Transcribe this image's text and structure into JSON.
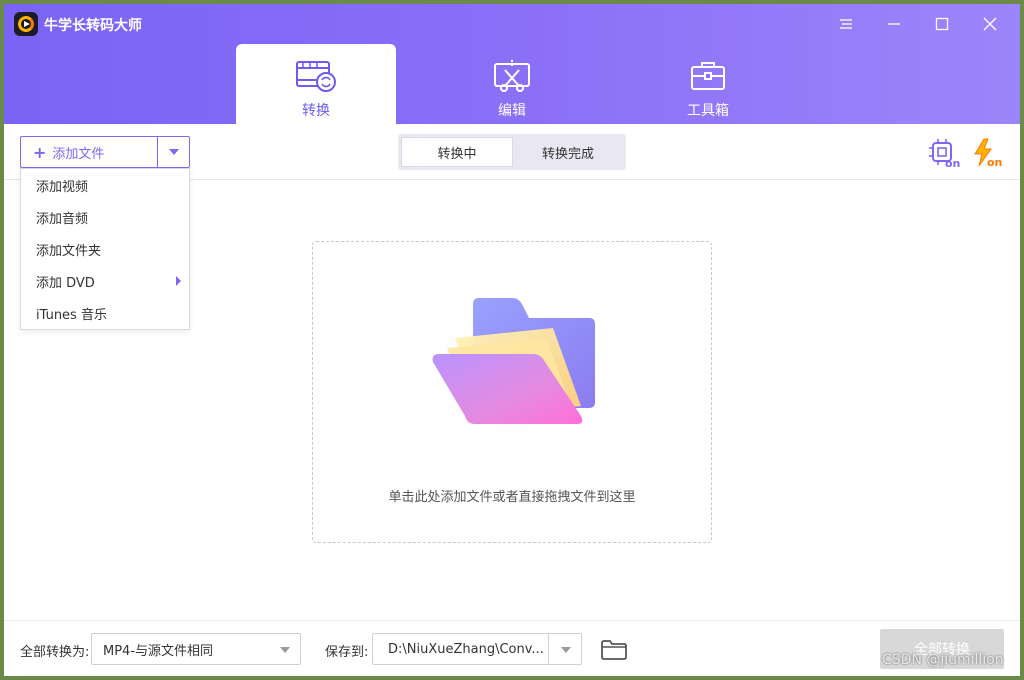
{
  "app": {
    "title": "牛学长转码大师"
  },
  "tabs": [
    {
      "label": "转换",
      "icon": "film-convert-icon",
      "active": true
    },
    {
      "label": "编辑",
      "icon": "edit-cut-icon",
      "active": false
    },
    {
      "label": "工具箱",
      "icon": "toolbox-icon",
      "active": false
    }
  ],
  "toolbar": {
    "add_file_label": "添加文件",
    "segments": [
      {
        "label": "转换中",
        "active": true
      },
      {
        "label": "转换完成",
        "active": false
      }
    ],
    "gpu_icon": "gpu-on-icon",
    "speed_icon": "lightning-on-icon"
  },
  "dropdown": {
    "items": [
      {
        "label": "添加视频"
      },
      {
        "label": "添加音频"
      },
      {
        "label": "添加文件夹"
      },
      {
        "label": "添加 DVD",
        "has_submenu": true
      },
      {
        "label": "iTunes 音乐"
      }
    ]
  },
  "dropzone": {
    "text": "单击此处添加文件或者直接拖拽文件到这里"
  },
  "bottom": {
    "convert_to_label": "全部转换为:",
    "format_value": "MP4-与源文件相同",
    "save_to_label": "保存到:",
    "save_path": "D:\\NiuXueZhang\\Conv...",
    "convert_all_label": "全部转换"
  },
  "watermark": "CSDN @jiumillion",
  "colors": {
    "accent": "#7c68f4",
    "header_start": "#7a64f5",
    "header_end": "#9c85fa",
    "on_badge": "#ff8a00"
  }
}
